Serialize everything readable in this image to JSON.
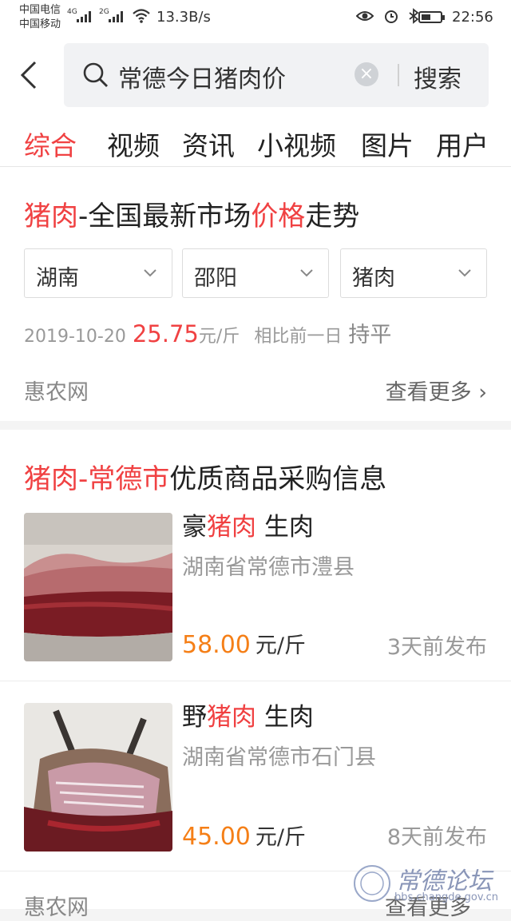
{
  "status_bar": {
    "carrier_1": "中国电信",
    "carrier_2": "中国移动",
    "net_1": "4G",
    "net_2": "2G",
    "speed": "13.3B/s",
    "time": "22:56",
    "battery_level": 0.5,
    "icons": [
      "eye-icon",
      "alarm-icon",
      "bluetooth-icon",
      "battery-icon"
    ]
  },
  "search": {
    "query": "常德今日猪肉价",
    "button": "搜索"
  },
  "tabs": [
    {
      "label": "综合",
      "active": true
    },
    {
      "label": "视频",
      "active": false
    },
    {
      "label": "资讯",
      "active": false
    },
    {
      "label": "小视频",
      "active": false
    },
    {
      "label": "图片",
      "active": false
    },
    {
      "label": "用户",
      "active": false
    }
  ],
  "market": {
    "title_hl1": "猪肉",
    "title_mid": "-全国最新市场",
    "title_hl2": "价格",
    "title_end": "走势",
    "selects": [
      "湖南",
      "邵阳",
      "猪肉"
    ],
    "date": "2019-10-20",
    "price": "25.75",
    "unit": "元/斤",
    "compare_label": "相比前一日",
    "trend": "持平",
    "source": "惠农网",
    "more": "查看更多 ›"
  },
  "supply": {
    "title_hl1": "猪肉",
    "title_dash": "-",
    "title_hl2": "常德市",
    "title_end": "优质商品采购信息",
    "items": [
      {
        "name_pre": "豪",
        "name_hl": "猪肉",
        "name_post": " 生肉",
        "location": "湖南省常德市澧县",
        "price": "58.00",
        "unit": "元/斤",
        "time": "3天前发布"
      },
      {
        "name_pre": "野",
        "name_hl": "猪肉",
        "name_post": " 生肉",
        "location": "湖南省常德市石门县",
        "price": "45.00",
        "unit": "元/斤",
        "time": "8天前发布"
      }
    ],
    "source": "惠农网",
    "more": "查看更多"
  },
  "watermark": {
    "text": "常德论坛",
    "url": "bbs.changde.gov.cn"
  },
  "colors": {
    "accent": "#f04142",
    "price_orange": "#f57f17"
  }
}
